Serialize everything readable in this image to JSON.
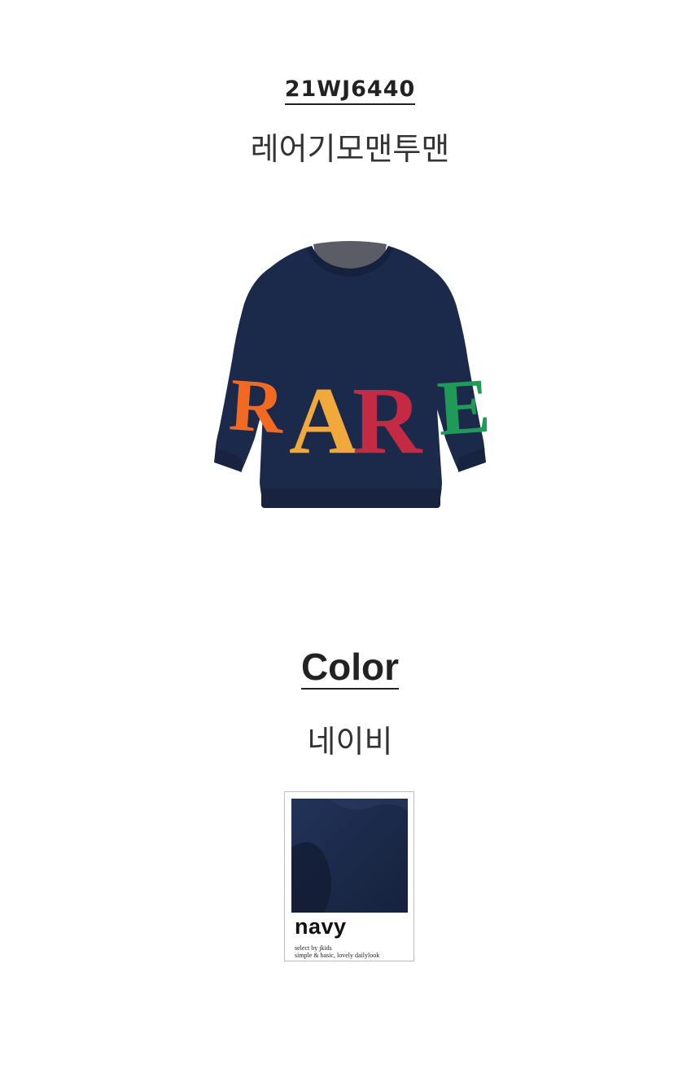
{
  "product": {
    "code": "21WJ6440",
    "name": "레어기모맨투맨",
    "image_icon": "navy-sweatshirt-illustration",
    "print_letters": [
      "R",
      "A",
      "R",
      "E"
    ]
  },
  "color_section": {
    "heading": "Color",
    "color_name": "네이비",
    "swatch": {
      "label": "navy",
      "tagline_1": "select by jkids",
      "tagline_2": "simple & basic, lovely dailylook",
      "hex": "#1b2a4a"
    }
  },
  "colors": {
    "navy": "#1b2a4a",
    "orange": "#f26a22",
    "yellow": "#f2a93b",
    "red": "#c42a44",
    "green": "#1f9a58",
    "text": "#222222"
  }
}
